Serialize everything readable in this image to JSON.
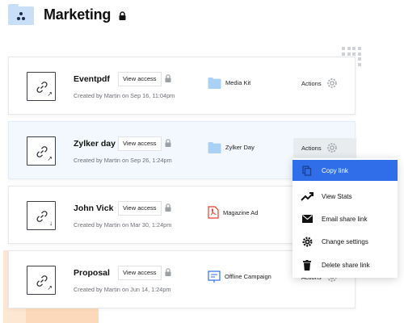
{
  "header": {
    "title": "Marketing"
  },
  "links": [
    {
      "name": "Eventpdf",
      "view_access": "View access",
      "created": "Created by Martin on Sep 16, 11:04pm",
      "destination": "Media Kit",
      "dest_type": "folder",
      "corner": "↗",
      "actions": "Actions"
    },
    {
      "name": "Zylker day",
      "view_access": "View access",
      "created": "Created by Martin on Sep 26, 1:24pm",
      "destination": "Zylker Day",
      "dest_type": "folder",
      "corner": "↗",
      "actions": "Actions"
    },
    {
      "name": "John Vick",
      "view_access": "View access",
      "created": "Created by Martin on Mar 30, 1:24pm",
      "destination": "Magazine Ad",
      "dest_type": "pdf",
      "corner": "↓",
      "actions": ""
    },
    {
      "name": "Proposal",
      "view_access": "View access",
      "created": "Created by Martin on Jun 14, 1:24pm",
      "destination": "Offline Campaign",
      "dest_type": "presentation",
      "corner": "↗",
      "actions": "Actions"
    }
  ],
  "menu": {
    "items": [
      {
        "label": "Copy link",
        "icon": "copy-icon"
      },
      {
        "label": "View Stats",
        "icon": "stats-icon"
      },
      {
        "label": "Email share link",
        "icon": "email-icon"
      },
      {
        "label": "Change settings",
        "icon": "gear-icon"
      },
      {
        "label": "Delete share link",
        "icon": "trash-icon"
      }
    ]
  },
  "colors": {
    "accent": "#2f6ee8",
    "folder": "#a9d1f5",
    "pdf": "#e2412a",
    "presentation": "#2f6ee8",
    "highlight_row": "#f2f8fe",
    "decoration": "#fde6d2"
  }
}
